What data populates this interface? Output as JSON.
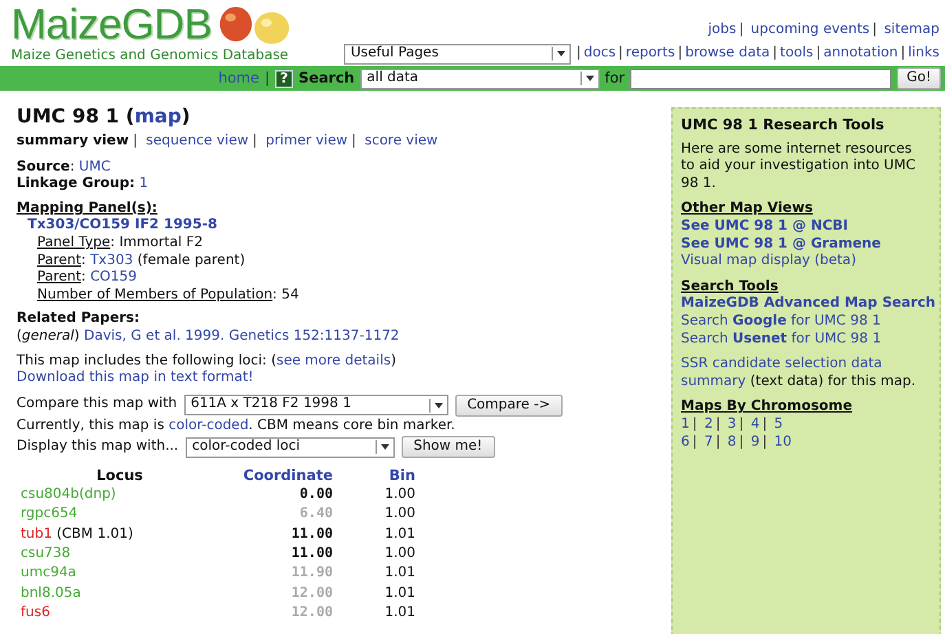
{
  "header": {
    "logo": "MaizeGDB",
    "tagline": "Maize Genetics and Genomics Database",
    "pages_select": "Useful Pages",
    "separator": "|",
    "top_links": [
      "jobs",
      "upcoming events",
      "sitemap"
    ],
    "nav_links": [
      "docs",
      "reports",
      "browse data",
      "tools",
      "annotation",
      "links"
    ]
  },
  "search_bar": {
    "home": "home",
    "separator": "|",
    "help_glyph": "?",
    "label": "Search",
    "scope": "all data",
    "for": "for",
    "go": "Go!"
  },
  "title": {
    "name": "UMC 98 1",
    "open": "(",
    "link": "map",
    "close": ")"
  },
  "views": [
    {
      "label": "summary view",
      "selected": true
    },
    {
      "label": "sequence view",
      "selected": false
    },
    {
      "label": "primer view",
      "selected": false
    },
    {
      "label": "score view",
      "selected": false
    }
  ],
  "view_separator": "|",
  "source": {
    "label": "Source",
    "colon": ":",
    "value": "UMC"
  },
  "linkage": {
    "label": "Linkage Group:",
    "value": "1"
  },
  "mapping_panel": {
    "heading": "Mapping Panel(s):",
    "name": "Tx303/CO159 IF2 1995-8",
    "colon": ":",
    "fields": [
      {
        "label": "Panel Type",
        "value": "Immortal F2"
      },
      {
        "label": "Parent",
        "link": "Tx303",
        "value": "(female parent)"
      },
      {
        "label": "Parent",
        "link": "CO159"
      },
      {
        "label": "Number of Members of Population",
        "value": "54"
      }
    ]
  },
  "related": {
    "heading": "Related Papers:",
    "papers": [
      {
        "category": "(*general*)",
        "citation": "Davis, G et al. 1999. Genetics 152:1137-1172"
      }
    ]
  },
  "loci_intro": {
    "before": "This map includes the following loci: (",
    "link": "see more details",
    "after": ")"
  },
  "download": "Download this map in text format!",
  "compare": {
    "label": "Compare this map with",
    "map": "611A x T218 F2 1998 1",
    "button": "Compare ->"
  },
  "color_note": {
    "before": "Currently, this map is ",
    "link": "color-coded",
    "after": ". CBM means core bin marker."
  },
  "display": {
    "label": "Display this map with...",
    "option": "color-coded loci",
    "button": "Show me!"
  },
  "table": {
    "columns": [
      "Locus",
      "Coordinate",
      "Bin"
    ],
    "rows": [
      {
        "locus": "csu804b(dnp)",
        "color": "#44aa33",
        "coordinate": "0.00",
        "coordinate_greyed": false,
        "bin": "1.00"
      },
      {
        "locus": "rgpc654",
        "color": "#44aa33",
        "coordinate": "6.40",
        "coordinate_greyed": true,
        "bin": "1.00"
      },
      {
        "locus": "tub1",
        "note": "(CBM 1.01)",
        "color": "#dd2222",
        "coordinate": "11.00",
        "coordinate_greyed": false,
        "bin": "1.01"
      },
      {
        "locus": "csu738",
        "color": "#44aa33",
        "coordinate": "11.00",
        "coordinate_greyed": false,
        "bin": "1.00"
      },
      {
        "locus": "umc94a",
        "color": "#44aa33",
        "coordinate": "11.90",
        "coordinate_greyed": true,
        "bin": "1.01"
      },
      {
        "locus": "bnl8.05a",
        "color": "#44aa33",
        "coordinate": "12.00",
        "coordinate_greyed": true,
        "bin": "1.01"
      },
      {
        "locus": "fus6",
        "color": "#dd2222",
        "coordinate": "12.00",
        "coordinate_greyed": true,
        "bin": "1.01"
      }
    ]
  },
  "sidebar": {
    "title": "UMC 98 1 Research Tools",
    "intro": "Here are some internet resources to aid your investigation into UMC 98 1.",
    "sections": [
      {
        "heading": "Other Map Views",
        "links": [
          {
            "text": "See UMC 98 1 @ NCBI",
            "bold": true
          },
          {
            "text": "See UMC 98 1 @ Gramene",
            "bold": true
          },
          {
            "text": "Visual map display (beta)",
            "bold": false
          }
        ]
      },
      {
        "heading": "Search Tools",
        "links": [
          {
            "text": "MaizeGDB Advanced Map Search",
            "bold": true
          },
          {
            "text": "Search **Google** for UMC 98 1",
            "bold": false
          },
          {
            "text": "Search **Usenet** for UMC 98 1",
            "bold": false
          }
        ]
      }
    ],
    "ssr": {
      "link_lines": [
        "SSR candidate selection data",
        "summary"
      ],
      "after": "(text data) for this map."
    },
    "chromosomes": {
      "heading": "Maps By Chromosome",
      "separator": "|",
      "rows": [
        [
          "1",
          "2",
          "3",
          "4",
          "5"
        ],
        [
          "6",
          "7",
          "8",
          "9",
          "10"
        ]
      ]
    }
  }
}
